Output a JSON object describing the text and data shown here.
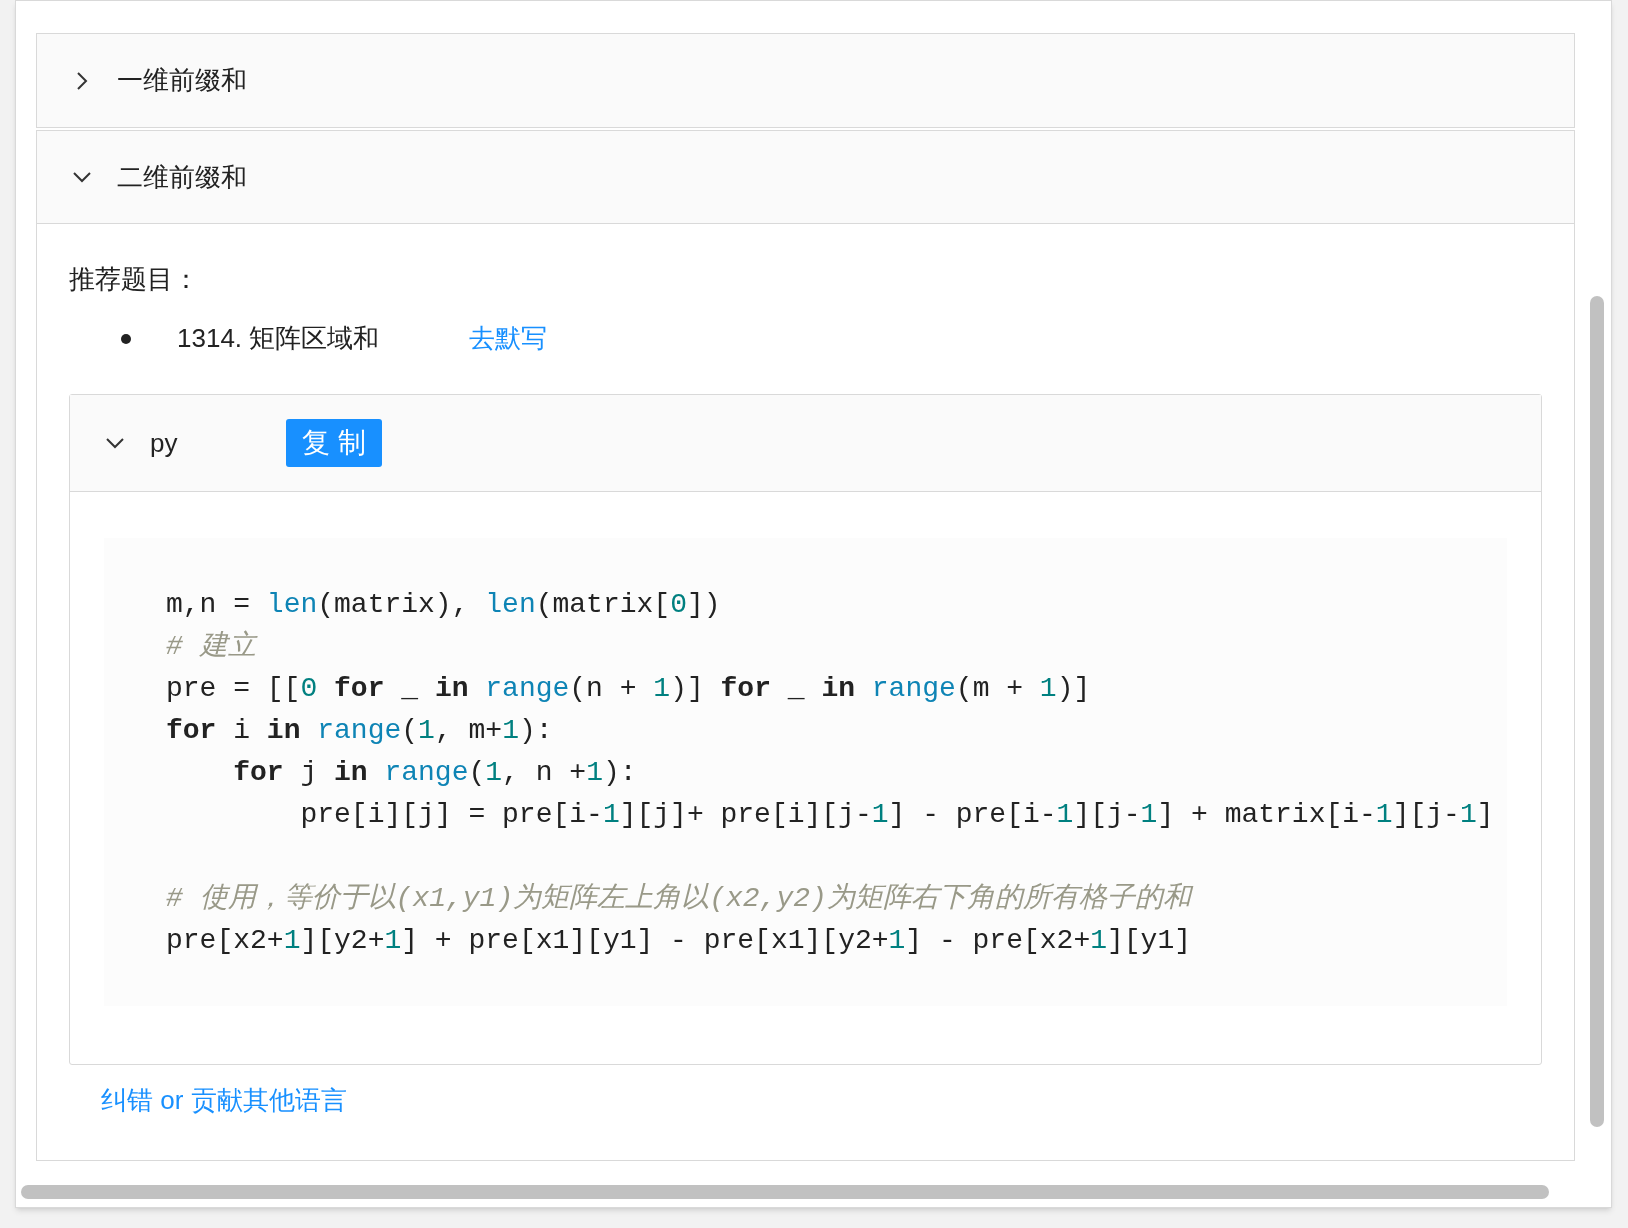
{
  "accordion": [
    {
      "title": "一维前缀和",
      "expanded": false
    },
    {
      "title": "二维前缀和",
      "expanded": true,
      "recommend_label": "推荐题目：",
      "problems": [
        {
          "title": "1314. 矩阵区域和",
          "link": "去默写"
        }
      ],
      "code_block": {
        "language": "py",
        "expanded": true,
        "copy_button": "复 制",
        "lines": [
          {
            "blank_before": false,
            "tokens": [
              {
                "text": "m,n = ",
                "kind": "plain"
              },
              {
                "text": "len",
                "kind": "builtin"
              },
              {
                "text": "(matrix), ",
                "kind": "plain"
              },
              {
                "text": "len",
                "kind": "builtin"
              },
              {
                "text": "(matrix[",
                "kind": "plain"
              },
              {
                "text": "0",
                "kind": "number"
              },
              {
                "text": "])",
                "kind": "plain"
              }
            ]
          },
          {
            "blank_before": false,
            "tokens": [
              {
                "text": "# 建立",
                "kind": "comment"
              }
            ]
          },
          {
            "blank_before": false,
            "tokens": [
              {
                "text": "pre = [[",
                "kind": "plain"
              },
              {
                "text": "0",
                "kind": "number"
              },
              {
                "text": " for",
                "kind": "keyword"
              },
              {
                "text": " _ ",
                "kind": "plain"
              },
              {
                "text": "in",
                "kind": "keyword"
              },
              {
                "text": " range",
                "kind": "builtin"
              },
              {
                "text": "(n + ",
                "kind": "plain"
              },
              {
                "text": "1",
                "kind": "number"
              },
              {
                "text": ")] ",
                "kind": "plain"
              },
              {
                "text": "for",
                "kind": "keyword"
              },
              {
                "text": " _ ",
                "kind": "plain"
              },
              {
                "text": "in",
                "kind": "keyword"
              },
              {
                "text": " range",
                "kind": "builtin"
              },
              {
                "text": "(m + ",
                "kind": "plain"
              },
              {
                "text": "1",
                "kind": "number"
              },
              {
                "text": ")]",
                "kind": "plain"
              }
            ]
          },
          {
            "blank_before": false,
            "tokens": [
              {
                "text": "for",
                "kind": "keyword"
              },
              {
                "text": " i ",
                "kind": "plain"
              },
              {
                "text": "in",
                "kind": "keyword"
              },
              {
                "text": " range",
                "kind": "builtin"
              },
              {
                "text": "(",
                "kind": "plain"
              },
              {
                "text": "1",
                "kind": "number"
              },
              {
                "text": ", m+",
                "kind": "plain"
              },
              {
                "text": "1",
                "kind": "number"
              },
              {
                "text": "):",
                "kind": "plain"
              }
            ]
          },
          {
            "blank_before": false,
            "tokens": [
              {
                "text": "    for",
                "kind": "keyword"
              },
              {
                "text": " j ",
                "kind": "plain"
              },
              {
                "text": "in",
                "kind": "keyword"
              },
              {
                "text": " range",
                "kind": "builtin"
              },
              {
                "text": "(",
                "kind": "plain"
              },
              {
                "text": "1",
                "kind": "number"
              },
              {
                "text": ", n +",
                "kind": "plain"
              },
              {
                "text": "1",
                "kind": "number"
              },
              {
                "text": "):",
                "kind": "plain"
              }
            ]
          },
          {
            "blank_before": false,
            "tokens": [
              {
                "text": "        pre[i][j] = pre[i-",
                "kind": "plain"
              },
              {
                "text": "1",
                "kind": "number"
              },
              {
                "text": "][j]+ pre[i][j-",
                "kind": "plain"
              },
              {
                "text": "1",
                "kind": "number"
              },
              {
                "text": "] - pre[i-",
                "kind": "plain"
              },
              {
                "text": "1",
                "kind": "number"
              },
              {
                "text": "][j-",
                "kind": "plain"
              },
              {
                "text": "1",
                "kind": "number"
              },
              {
                "text": "] + matrix[i-",
                "kind": "plain"
              },
              {
                "text": "1",
                "kind": "number"
              },
              {
                "text": "][j-",
                "kind": "plain"
              },
              {
                "text": "1",
                "kind": "number"
              },
              {
                "text": "]",
                "kind": "plain"
              }
            ]
          },
          {
            "blank_before": true,
            "tokens": [
              {
                "text": "# 使用，等价于以(x1,y1)为矩阵左上角以(x2,y2)为矩阵右下角的所有格子的和",
                "kind": "comment"
              }
            ]
          },
          {
            "blank_before": false,
            "tokens": [
              {
                "text": "pre[x2+",
                "kind": "plain"
              },
              {
                "text": "1",
                "kind": "number"
              },
              {
                "text": "][y2+",
                "kind": "plain"
              },
              {
                "text": "1",
                "kind": "number"
              },
              {
                "text": "] + pre[x1][y1] - pre[x1][y2+",
                "kind": "plain"
              },
              {
                "text": "1",
                "kind": "number"
              },
              {
                "text": "] - pre[x2+",
                "kind": "plain"
              },
              {
                "text": "1",
                "kind": "number"
              },
              {
                "text": "][y1]",
                "kind": "plain"
              }
            ]
          }
        ]
      },
      "footer_link": "纠错 or 贡献其他语言"
    }
  ]
}
